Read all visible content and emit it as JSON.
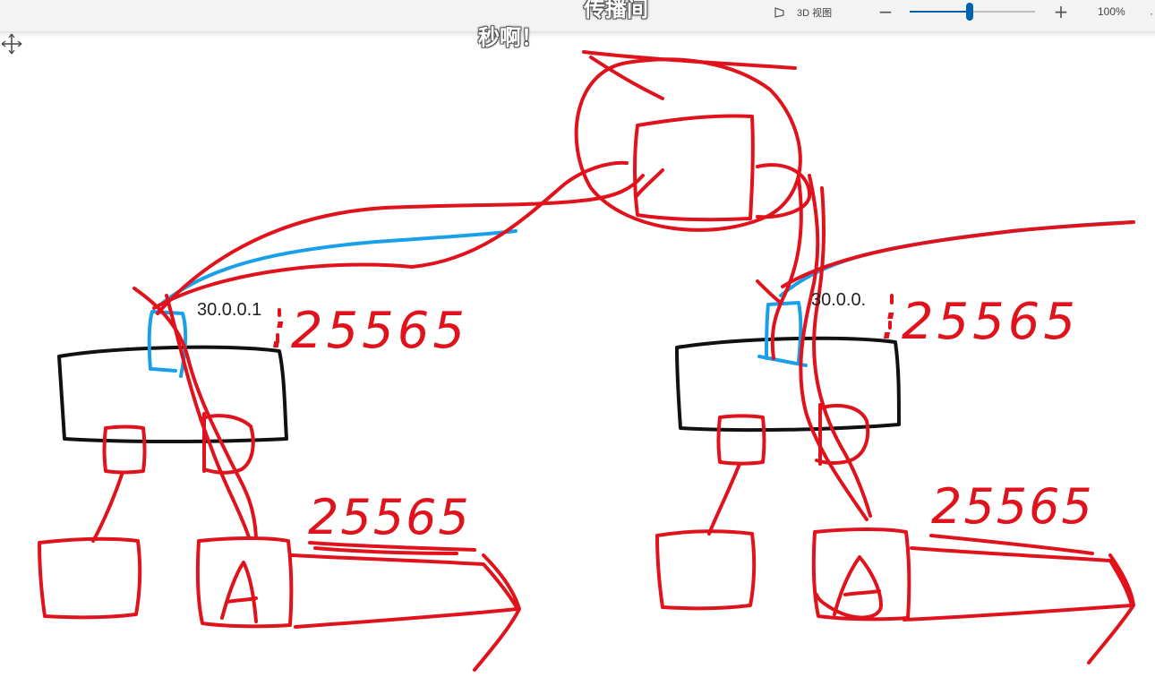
{
  "subtitles": {
    "top": "传播间",
    "main": "秒啊！"
  },
  "toolbar": {
    "view_3d_label": "3D 视图",
    "zoom_minus": "−",
    "zoom_plus": "+",
    "zoom_value": "100%",
    "edge_glyph": "·",
    "zoom_level_fraction": 0.48,
    "accent_color": "#0063b1"
  },
  "drawing": {
    "left_ip": "30.0.0.1",
    "right_ip": "30.0.0.",
    "left_handwritten_port": ":25565",
    "right_handwritten_port": ":25565",
    "left_bottom_port": "25565",
    "right_bottom_port": "25565",
    "host_letter": "A",
    "ink_red": "#e0121b",
    "ink_blue": "#1aa0e8",
    "ink_black": "#111111"
  }
}
